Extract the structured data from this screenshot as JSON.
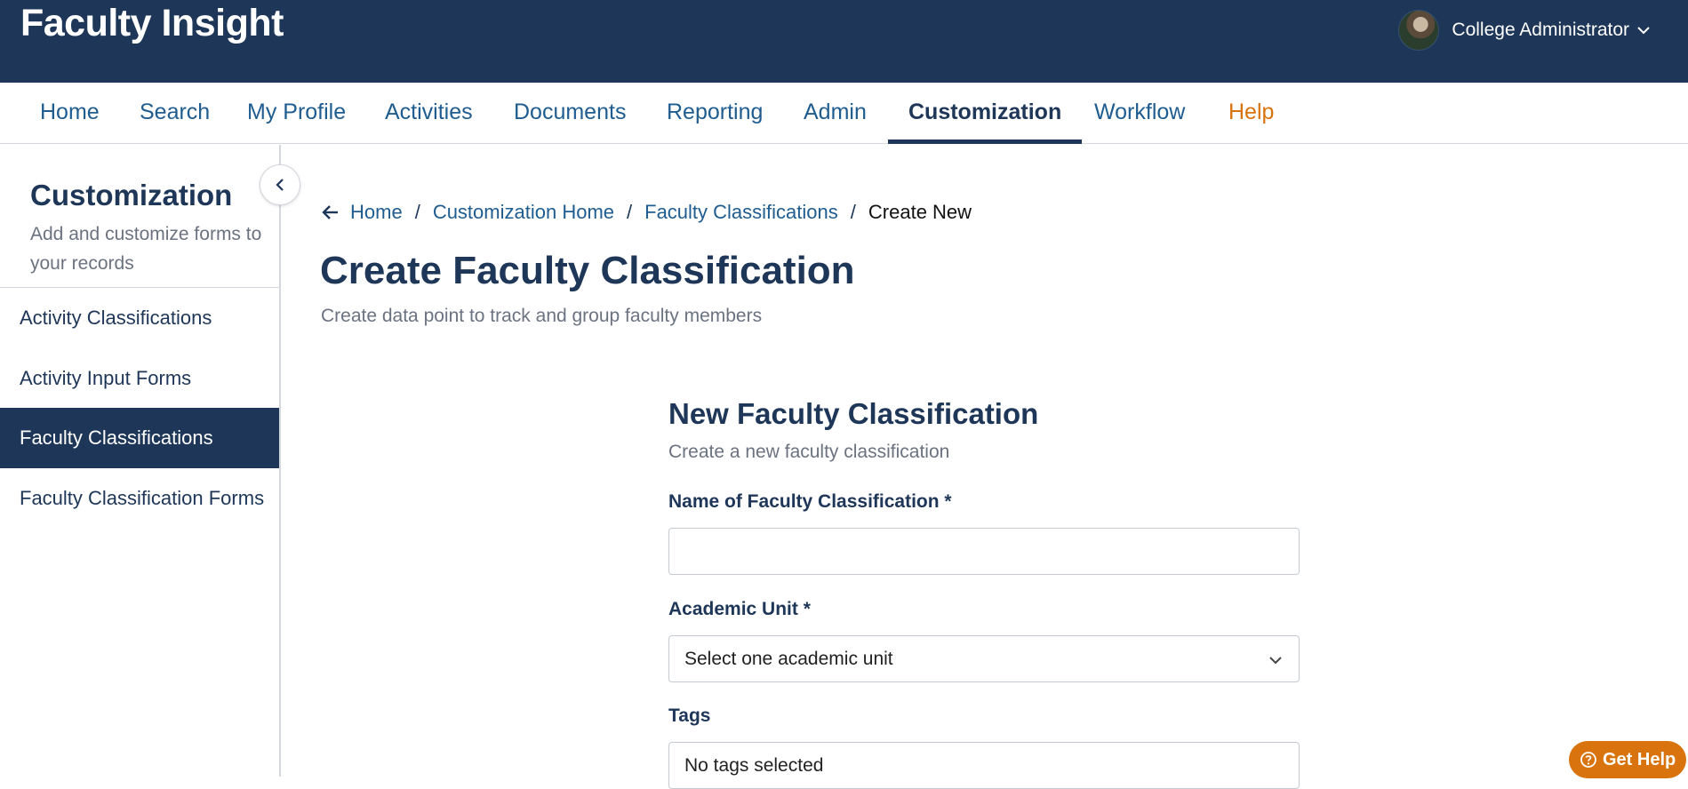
{
  "app": {
    "title": "Faculty Insight"
  },
  "user": {
    "name": "College Administrator"
  },
  "nav": {
    "items": [
      {
        "label": "Home"
      },
      {
        "label": "Search"
      },
      {
        "label": "My Profile"
      },
      {
        "label": "Activities"
      },
      {
        "label": "Documents"
      },
      {
        "label": "Reporting"
      },
      {
        "label": "Admin"
      },
      {
        "label": "Customization",
        "active": true
      },
      {
        "label": "Workflow"
      },
      {
        "label": "Help"
      }
    ]
  },
  "sidebar": {
    "title": "Customization",
    "subtitle": "Add and customize forms to your records",
    "items": [
      {
        "label": "Activity Classifications"
      },
      {
        "label": "Activity Input Forms"
      },
      {
        "label": "Faculty Classifications",
        "active": true
      },
      {
        "label": "Faculty Classification Forms"
      }
    ]
  },
  "breadcrumb": {
    "items": [
      "Home",
      "Customization Home",
      "Faculty Classifications"
    ],
    "current": "Create New",
    "separator": "/"
  },
  "page": {
    "title": "Create Faculty Classification",
    "subtitle": "Create data point to track and group faculty members"
  },
  "form": {
    "title": "New Faculty Classification",
    "subtitle": "Create a new faculty classification",
    "name_label": "Name of Faculty Classification *",
    "name_value": "",
    "unit_label": "Academic Unit *",
    "unit_value": "Select one academic unit",
    "tags_label": "Tags",
    "tags_value": "No tags selected"
  },
  "help_button": {
    "label": "Get Help"
  },
  "colors": {
    "primary": "#1e3658",
    "link": "#1f5c8f",
    "accent": "#d9730d"
  },
  "icons": {
    "user_menu": "chevron-down-icon",
    "back": "arrow-left-icon",
    "collapse": "chevron-left-icon",
    "select": "chevron-down-icon",
    "help": "question-circle-icon"
  }
}
